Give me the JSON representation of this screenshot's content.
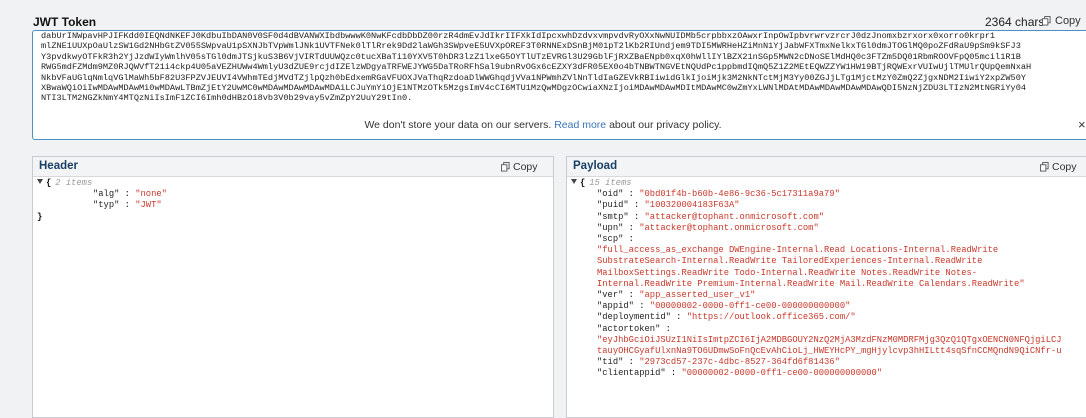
{
  "token": {
    "title": "JWT Token",
    "char_count": "2364 chars",
    "copy_label": "Copy",
    "lines": [
      "dabUrINWpavHPJIFKdd0IEQNdNKEFJ0KdbuIbDAN0V0SF0d4dBVANWXIbdbwwwK0NwKFcdbDbDZ00rzR4dmEvJdIkrIIFXkIdIpcxwhDzdvxvmpvdvRyOXxNwNUIDMb5crpbbxzOAwxrInpOwIpbvrwrvzrcrJ0dzJnomxbzrxorx0xorro0krpr1",
      "mlZNE1UUXpOaUlzSW1Gd2NHbGtZV055SWpvaU1pSXNJbTVpWmlJNk1UVTFNek0lTlRrek9Dd2laWGh3SWpveE5UVXpOREF3T0RNNExDSnBjM01pT2lKb2RIUndjem9TDI5MWRHeHZiMnN1YjJabWFXTmxNelkxTGl0dmJTOGlMQ0poZFdRaU9pSm9kSFJ3",
      "Y3pvdkwyOTFkR3h2YjJzdWIyWmlhV05sTGl0dmJTSjkuS3B6VjVIRTdUUWQzc0tucXBaTi10YXV5T0hDR3lzZ1lxeG5OYTlUTzEVRGl3U29GblFjRXZBaENpb0xqX0hWllIYlBZX21nSGp5MWN2cDNoSElMdHQ0c3FTZm5DQ01RbmROOVFpQ05mcil1R1B",
      "RWG5mdFZMdm9MZ0RJQWVfT21i4ckp4U05aVEZHUWw4WmlyU3dZUE9rcjdIZElzWDgyaTRFWEJYWG5DaTRoRFhSal9ubnRvOGx6cEZXY3dFR05EX0o4bTNBWTNGVEtNQUdPc1ppbmdIQmQ5Z1Z2MEtEQWZZYW1HW19BTjRQWExrVUIwUjlTMUlrQUpQemNxaH",
      "NkbVFaUGlqNmlqVGlMaWh5bF82U3FPZVJEUVI4VWhmTEdjMVdTZjlpQzh0bEdxemRGaVFUOXJVaThqRzdoaDlWWGhqdjVVa1NPWmhZVlNnTldIaGZEVkRBIiwidGlkIjoiMjk3M2NkNTctMjM3Yy00ZGJjLTg1MjctMzY0ZmQ2ZjgxNDM2IiwiY2xpZW50Y",
      "XBwaWQiOiIwMDAwMDAwMi0wMDAwLTBmZjEtY2UwMC0wMDAwMDAwMDAwMDAiLCJuYmYiOjE1NTMzOTk5MzgsImV4cCI6MTU1MzQwMDgzOCwiaXNzIjoiMDAwMDAwMDItMDAwMC0wZmYxLWNlMDAtMDAwMDAwMDAwMDAwQDI5NzNjZDU3LTIzN2MtNGRiYy04",
      "NTI3LTM2NGZkNmY4MTQzNiIsImF1ZCI6Imh0dHBzOi8vb3V0b29vay5vZmZpY2UuY29tIn0."
    ]
  },
  "notice": {
    "text_before": "We don't store your data on our servers. ",
    "link_text": "Read more",
    "text_after": " about our privacy policy.",
    "close_glyph": "×"
  },
  "header_panel": {
    "title": "Header",
    "copy_label": "Copy",
    "item_count": "2 items",
    "open_brace": "{",
    "close_brace": "}",
    "fields": [
      {
        "key": "\"alg\"",
        "value": "\"none\""
      },
      {
        "key": "\"typ\"",
        "value": "\"JWT\""
      }
    ]
  },
  "payload_panel": {
    "title": "Payload",
    "copy_label": "Copy",
    "item_count": "15 items",
    "open_brace": "{",
    "fields": [
      {
        "key": "\"oid\"",
        "value": "\"0bd01f4b-b60b-4e86-9c36-5c17311a9a79\""
      },
      {
        "key": "\"puid\"",
        "value": "\"100320004183F63A\""
      },
      {
        "key": "\"smtp\"",
        "value": "\"attacker@tophant.onmicrosoft.com\""
      },
      {
        "key": "\"upn\"",
        "value": "\"attacker@tophant.onmicrosoft.com\""
      }
    ],
    "scp_key": "\"scp\"",
    "scp_lines": [
      "\"full_access_as_exchange DWEngine-Internal.Read Locations-Internal.ReadWrite",
      "SubstrateSearch-Internal.ReadWrite TailoredExperiences-Internal.ReadWrite",
      "MailboxSettings.ReadWrite Todo-Internal.ReadWrite Notes.ReadWrite Notes-",
      "Internal.ReadWrite Premium-Internal.ReadWrite Mail.ReadWrite Calendars.ReadWrite\""
    ],
    "fields2": [
      {
        "key": "\"ver\"",
        "value": "\"app_asserted_user_v1\""
      },
      {
        "key": "\"appid\"",
        "value": "\"00000002-0000-0ff1-ce00-000000000000\""
      },
      {
        "key": "\"deploymentid\"",
        "value": "\"https://outlook.office365.com/\""
      }
    ],
    "actortoken_key": "\"actortoken\"",
    "actortoken_lines": [
      "\"eyJhbGciOiJSUzI1NiIsImtpZCI6IjA2MDBGOUY2NzQ2MjA3MzdFNzM0MDRFMjg3QzQ1QTgxOENCN0NFQjgiLCJ",
      "tauyOHCGyafUlxnNa9TO6UDmwSoFnQcEvAhCioLj_HWEYHcPY_mgHjylcvp3hHILtt4sqSfnCCMQndN9QiCNfr-u"
    ],
    "fields3": [
      {
        "key": "\"tid\"",
        "value": "\"2973cd57-237c-4dbc-8527-364fd6f81436\""
      },
      {
        "key": "\"clientappid\"",
        "value": "\"00000002-0000-0ff1-ce00-000000000000\""
      }
    ]
  }
}
